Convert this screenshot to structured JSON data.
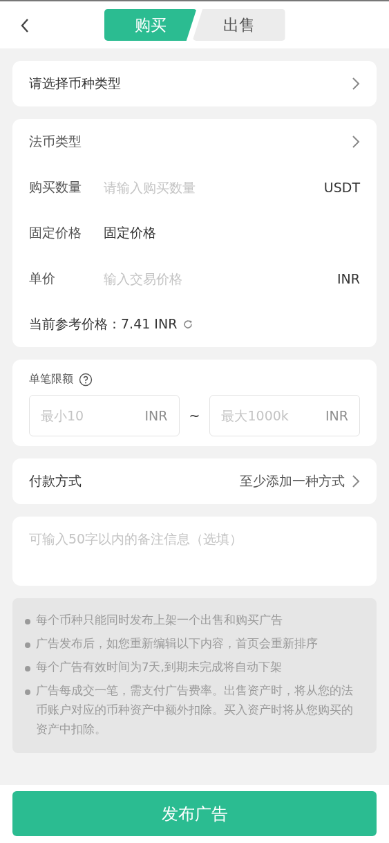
{
  "header": {
    "tabs": [
      {
        "label": "购买",
        "selected": true
      },
      {
        "label": "出售",
        "selected": false
      }
    ]
  },
  "coin_select": {
    "label": "请选择币种类型"
  },
  "form": {
    "rows": [
      {
        "kind": "link",
        "label": "法币类型"
      },
      {
        "kind": "input",
        "label": "购买数量",
        "placeholder": "请输入购买数量",
        "unit": "USDT"
      },
      {
        "kind": "text",
        "label": "固定价格",
        "value": "固定价格"
      },
      {
        "kind": "input",
        "label": "单价",
        "placeholder": "输入交易价格",
        "unit": "INR"
      }
    ],
    "reference": "当前参考价格：7.41 INR"
  },
  "limit": {
    "label": "单笔限额",
    "min": {
      "placeholder": "最小10",
      "unit": "INR"
    },
    "separator": "~",
    "max": {
      "placeholder": "最大1000k",
      "unit": "INR"
    }
  },
  "payment": {
    "label": "付款方式",
    "value": "至少添加一种方式"
  },
  "remark": {
    "placeholder": "可输入50字以内的备注信息（选填）"
  },
  "notes": [
    "每个币种只能同时发布上架一个出售和购买广告",
    "广告发布后，如您重新编辑以下内容，首页会重新排序",
    "每个广告有效时间为7天,到期未完成将自动下架",
    "广告每成交一笔，需支付广告费率。出售资产时，将从您的法币账户对应的币种资产中额外扣除。买入资产时将从您购买的资产中扣除。"
  ],
  "submit": "发布广告"
}
